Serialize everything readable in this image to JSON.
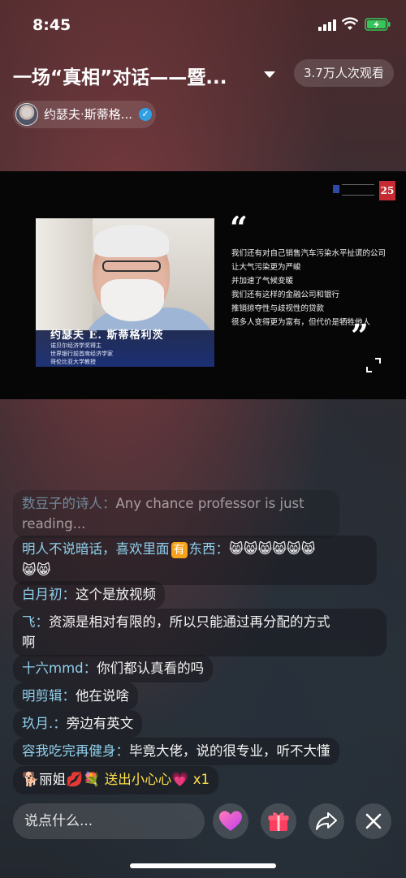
{
  "status": {
    "time": "8:45"
  },
  "header": {
    "title": "一场“真相”对话——暨...",
    "viewers": "3.7万人次观看",
    "host_name": "约瑟夫·斯蒂格..."
  },
  "video": {
    "anniversary_badge": "25",
    "speaker_name": "约瑟夫 E. 斯蒂格利茨",
    "speaker_titles": [
      "诺贝尔经济学奖得主",
      "世界银行前首席经济学家",
      "哥伦比亚大学教授"
    ],
    "quote_lines": [
      "我们还有对自己销售汽车污染水平扯谎的公司",
      "让大气污染更为严峻",
      "并加速了气候变暖",
      "我们还有这样的金融公司和银行",
      "推销掠夺性与歧视性的贷款",
      "很多人变得更为富有，但代价是牺牲他人"
    ]
  },
  "chat": [
    {
      "user": "数豆子的诗人：",
      "text": "Any chance professor is just",
      "text2": "reading..."
    },
    {
      "user": "明人不说暗话，喜欢里面",
      "badge": "有",
      "user_tail": "东西：",
      "emoji": "😸😸😸😸😸😸",
      "emoji2": "😸😸"
    },
    {
      "user": "白月初：",
      "text": "这个是放视频"
    },
    {
      "user": "飞：",
      "text": "资源是相对有限的，所以只能通过再分配的方式",
      "text2": "啊"
    },
    {
      "user": "十六mmd：",
      "text": "你们都认真看的吗"
    },
    {
      "user": "明剪辑：",
      "text": "他在说啥"
    },
    {
      "user": "玖月.：",
      "text": "旁边有英文"
    },
    {
      "user": "容我吃完再健身：",
      "text": "毕竟大佬，说的很专业，听不大懂"
    }
  ],
  "gift": {
    "icons": "🐕",
    "user": "丽姐",
    "deco": "💋💐",
    "text": "送出小心心",
    "heart": "💗",
    "count": "x1"
  },
  "bottom": {
    "placeholder": "说点什么..."
  },
  "icons": {
    "signal": "signal-icon",
    "wifi": "wifi-icon",
    "battery": "battery-charging-icon",
    "heart": "heart-icon",
    "gift": "gift-icon",
    "share": "share-icon",
    "close": "close-icon",
    "fullscreen": "fullscreen-icon",
    "verified": "verified-icon"
  },
  "colors": {
    "username": "#8fd0ec",
    "gift_text": "#ffe04a",
    "verified": "#2fa0e4",
    "battery": "#35c759"
  }
}
